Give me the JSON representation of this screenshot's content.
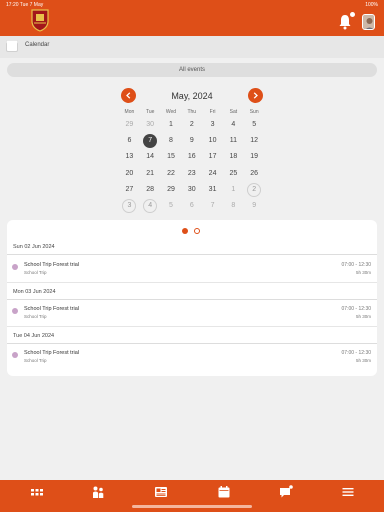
{
  "status": {
    "time_date": "17:20  Tue 7 May",
    "battery": "100%"
  },
  "header": {
    "logo": "school-crest",
    "bell_icon": "bell-icon",
    "avatar": "user-avatar"
  },
  "section": {
    "title": "Calendar"
  },
  "filter": {
    "label": "All events"
  },
  "calendar": {
    "month_label": "May, 2024",
    "weekdays": [
      "Mon",
      "Tue",
      "Wed",
      "Thu",
      "Fri",
      "Sat",
      "Sun"
    ],
    "weeks": [
      [
        "29",
        "30",
        "1",
        "2",
        "3",
        "4",
        "5"
      ],
      [
        "6",
        "7",
        "8",
        "9",
        "10",
        "11",
        "12"
      ],
      [
        "13",
        "14",
        "15",
        "16",
        "17",
        "18",
        "19"
      ],
      [
        "20",
        "21",
        "22",
        "23",
        "24",
        "25",
        "26"
      ],
      [
        "27",
        "28",
        "29",
        "30",
        "31",
        "1",
        "2"
      ],
      [
        "3",
        "4",
        "5",
        "6",
        "7",
        "8",
        "9"
      ]
    ],
    "selected_day": "7"
  },
  "pager": {
    "pages": 2,
    "current": 1
  },
  "agenda": [
    {
      "date": "Sun 02 Jun 2024",
      "events": [
        {
          "title": "School Trip Forest trial",
          "category": "School Trip",
          "time": "07:00 - 12:30",
          "duration": "5h 30m"
        }
      ]
    },
    {
      "date": "Mon 03 Jun 2024",
      "events": [
        {
          "title": "School Trip Forest trial",
          "category": "School Trip",
          "time": "07:00 - 12:30",
          "duration": "5h 30m"
        }
      ]
    },
    {
      "date": "Tue 04 Jun 2024",
      "events": [
        {
          "title": "School Trip Forest trial",
          "category": "School Trip",
          "time": "07:00 - 12:30",
          "duration": "5h 30m"
        }
      ]
    }
  ],
  "footer_tabs": [
    "apps-grid-icon",
    "people-icon",
    "news-icon",
    "calendar-icon",
    "chat-icon",
    "menu-icon"
  ],
  "colors": {
    "brand": "#de4f18",
    "event_dot": "#c8a3c8",
    "background": "#f0f0f0"
  }
}
